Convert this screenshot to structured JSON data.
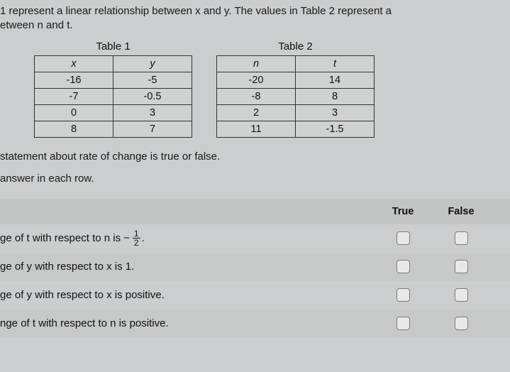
{
  "intro": {
    "line1": "1 represent a linear relationship between x and y. The values in Table 2 represent a",
    "line2": "etween n and t."
  },
  "table1": {
    "title": "Table 1",
    "headX": "x",
    "headY": "y",
    "rows": [
      {
        "x": "-16",
        "y": "-5"
      },
      {
        "x": "-7",
        "y": "-0.5"
      },
      {
        "x": "0",
        "y": "3"
      },
      {
        "x": "8",
        "y": "7"
      }
    ]
  },
  "table2": {
    "title": "Table 2",
    "headN": "n",
    "headT": "t",
    "rows": [
      {
        "n": "-20",
        "t": "14"
      },
      {
        "n": "-8",
        "t": "8"
      },
      {
        "n": "2",
        "t": "3"
      },
      {
        "n": "11",
        "t": "-1.5"
      }
    ]
  },
  "midText": {
    "s1": "statement about rate of change is true or false.",
    "s2": "answer in each row."
  },
  "tf": {
    "trueLabel": "True",
    "falseLabel": "False"
  },
  "questions": {
    "q1_pre": "ge of t with respect to n is ",
    "q1_neg": "−",
    "q1_num": "1",
    "q1_den": "2",
    "q1_post": ".",
    "q2": "ge of y with respect to x is 1.",
    "q3": "ge of y with respect to x is positive.",
    "q4": "nge of t with respect to n is positive."
  }
}
